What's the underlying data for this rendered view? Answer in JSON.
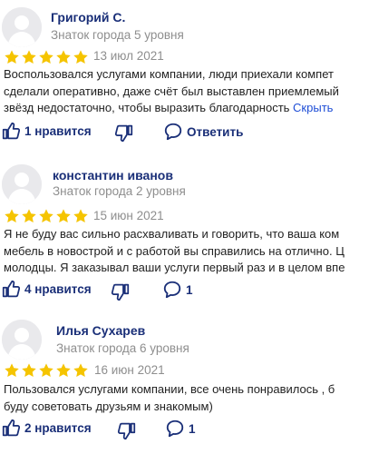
{
  "reviews": [
    {
      "author": "Григорий С.",
      "level": "Знаток города 5 уровня",
      "rating": 5,
      "date": "13 июл 2021",
      "lines": [
        "Воспользовался услугами компании, люди приехали компет",
        "сделали оперативно, даже счёт был выставлен приемлемый",
        "звёзд недостаточно, чтобы выразить благодарность"
      ],
      "more": "Скрыть",
      "likes": "1 нравится",
      "reply": "Ответить"
    },
    {
      "author": "константин иванов",
      "level": "Знаток города 2 уровня",
      "rating": 5,
      "date": "15 июн 2021",
      "lines": [
        "Я не буду вас сильно расхваливать и говорить, что ваша ком",
        "мебель в новострой и с работой вы справились на отлично. Ц",
        "молодцы. Я заказывал ваши услуги первый раз и в целом впе"
      ],
      "likes": "4 нравится",
      "comments": "1"
    },
    {
      "author": "Илья Сухарев",
      "level": "Знаток города 6 уровня",
      "rating": 5,
      "date": "16 июн 2021",
      "lines": [
        "Пользовался услугами компании, все очень понравилось , б",
        "буду советовать друзьям и знакомым)"
      ],
      "likes": "2 нравится",
      "comments": "1"
    }
  ],
  "colors": {
    "star": "#f5c400",
    "name": "#1a2f78",
    "muted": "#8e8e8e",
    "link": "#1f4ed6"
  },
  "icons": {
    "avatar": "avatar-placeholder-icon",
    "star": "star-icon",
    "like": "thumb-up-icon",
    "dislike": "thumb-down-icon",
    "comment": "comment-bubble-icon"
  }
}
